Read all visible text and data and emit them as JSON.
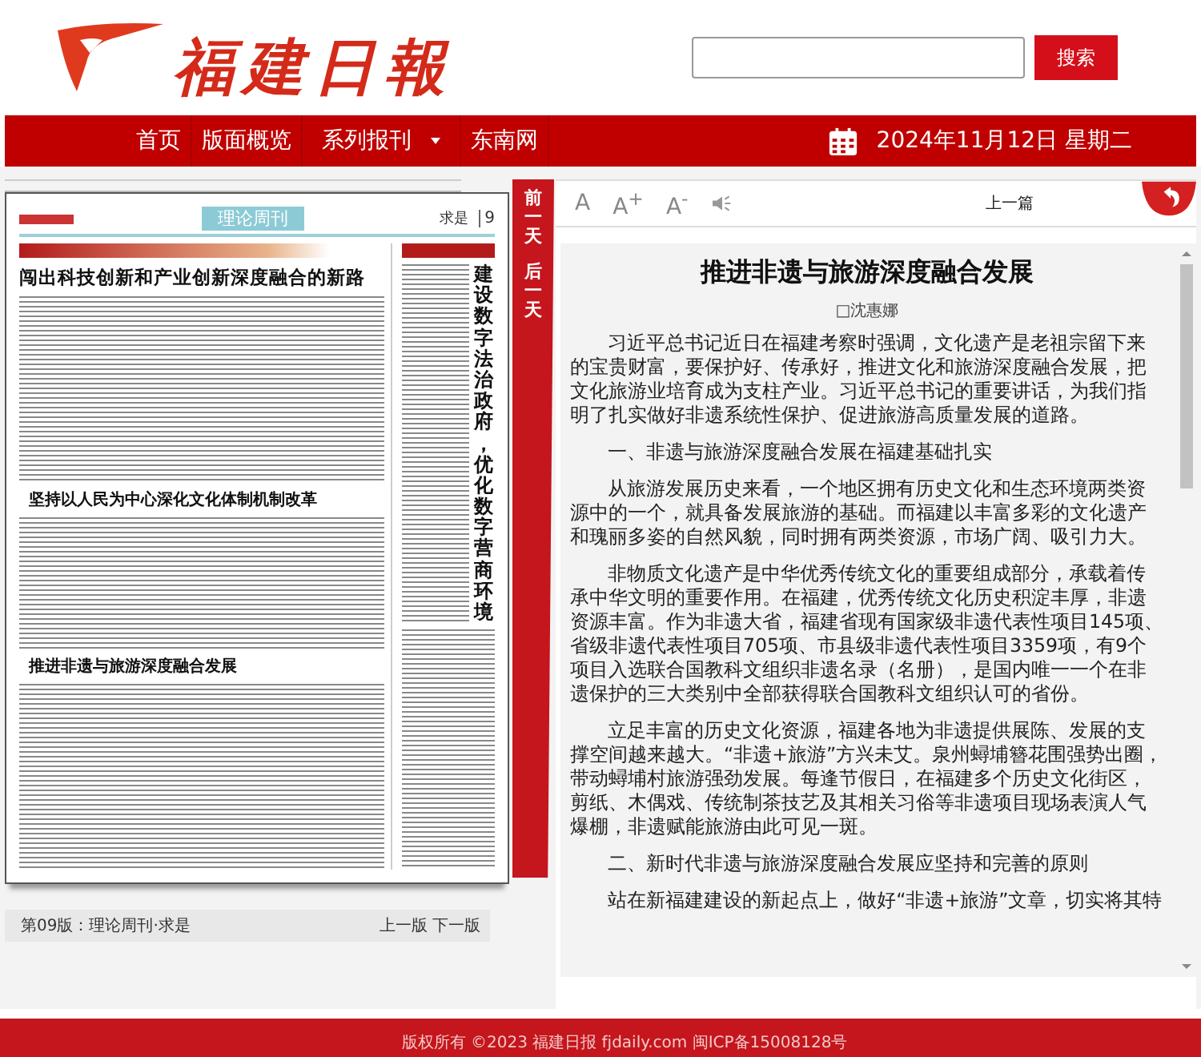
{
  "header": {
    "logo_text": "福建日報",
    "search": {
      "button": "搜索"
    }
  },
  "nav": {
    "items": [
      {
        "label": "首页",
        "dropdown": false
      },
      {
        "label": "版面概览",
        "dropdown": false
      },
      {
        "label": "系列报刊",
        "dropdown": true
      },
      {
        "label": "东南网",
        "dropdown": false
      }
    ],
    "date": "2024年11月12日 星期二"
  },
  "page_view": {
    "masthead": "理论周刊",
    "section": "求是",
    "page_number": "9",
    "headlines": [
      "闯出科技创新和产业创新深度融合的新路",
      "坚持以人民为中心深化文化体制机制改革",
      "推进非遗与旅游深度融合发展"
    ],
    "vertical_headline": "建设数字法治政府，优化数字营商环境",
    "day_nav": [
      "前一天",
      "后一天"
    ],
    "page_label": "第09版：理论周刊·求是",
    "page_nav": [
      "上一版",
      "下一版"
    ]
  },
  "toolbar": {
    "font_buttons": [
      "A",
      "A$^{+}$",
      "A$^{-}$"
    ],
    "prev_article": "上一篇"
  },
  "article": {
    "title": "推进非遗与旅游深度融合发展",
    "byline": "□沈惠娜",
    "paragraphs": [
      "习近平总书记近日在福建考察时强调，文化遗产是老祖宗留下来的宝贵财富，要保护好、传承好，推进文化和旅游深度融合发展，把文化旅游业培育成为支柱产业。习近平总书记的重要讲话，为我们指明了扎实做好非遗系统性保护、促进旅游高质量发展的道路。",
      "一、非遗与旅游深度融合发展在福建基础扎实",
      "从旅游发展历史来看，一个地区拥有历史文化和生态环境两类资源中的一个，就具备发展旅游的基础。而福建以丰富多彩的文化遗产和瑰丽多姿的自然风貌，同时拥有两类资源，市场广阔、吸引力大。",
      "非物质文化遗产是中华优秀传统文化的重要组成部分，承载着传承中华文明的重要作用。在福建，优秀传统文化历史积淀丰厚，非遗资源丰富。作为非遗大省，福建省现有国家级非遗代表性项目145项、省级非遗代表性项目705项、市县级非遗代表性项目3359项，有9个项目入选联合国教科文组织非遗名录（名册），是国内唯一一个在非遗保护的三大类别中全部获得联合国教科文组织认可的省份。",
      "立足丰富的历史文化资源，福建各地为非遗提供展陈、发展的支撑空间越来越大。“非遗+旅游”方兴未艾。泉州蟳埔簪花围强势出圈，带动蟳埔村旅游强劲发展。每逢节假日，在福建多个历史文化街区，剪纸、木偶戏、传统制茶技艺及其相关习俗等非遗项目现场表演人气爆棚，非遗赋能旅游由此可见一斑。",
      "二、新时代非遗与旅游深度融合发展应坚持和完善的原则",
      "站在新福建建设的新起点上，做好“非遗+旅游”文章，切实将其特"
    ]
  },
  "footer": "版权所有 ©2023 福建日报 fjdaily.com 闽ICP备15008128号"
}
